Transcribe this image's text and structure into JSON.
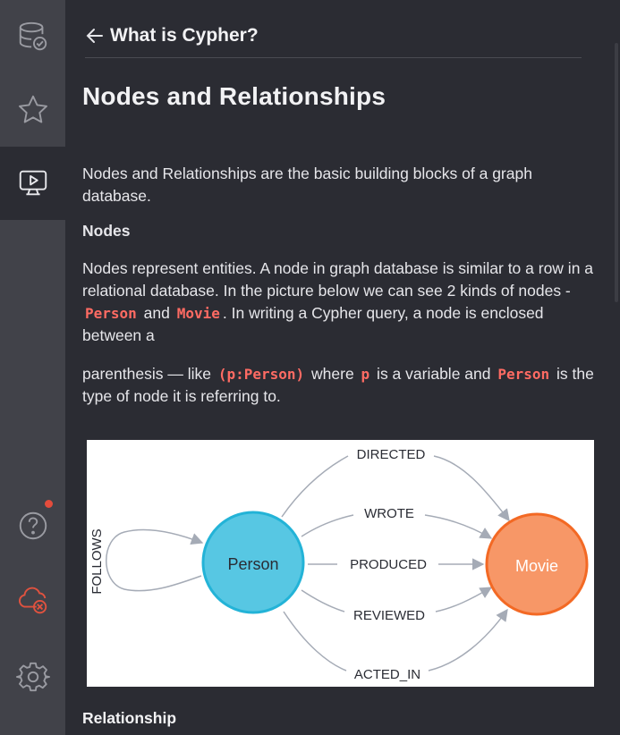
{
  "header": {
    "title": "What is Cypher?"
  },
  "page": {
    "title": "Nodes and Relationships"
  },
  "intro": "Nodes and Relationships are the basic building blocks of a graph database.",
  "nodes_heading": "Nodes",
  "nodes_para": {
    "t1": "Nodes represent entities. A node in graph database is similar to a row in a relational database. In the picture below we can see 2 kinds of nodes - ",
    "c1": "Person",
    "t2": " and ",
    "c2": "Movie",
    "t3": ". In writing a Cypher query, a node is enclosed between a"
  },
  "paren_para": {
    "t1": "parenthesis — like ",
    "c1": "(p:Person)",
    "t2": " where ",
    "c2": "p",
    "t3": " is a variable and ",
    "c3": "Person",
    "t4": " is the type of node it is referring to."
  },
  "diagram": {
    "nodes": {
      "person": "Person",
      "movie": "Movie"
    },
    "edges": {
      "directed": "DIRECTED",
      "wrote": "WROTE",
      "produced": "PRODUCED",
      "reviewed": "REVIEWED",
      "acted_in": "ACTED_IN",
      "follows": "FOLLOWS"
    },
    "colors": {
      "person": "#57c7e3",
      "person_border": "#23b3d7",
      "movie": "#f79767",
      "movie_border": "#f36924",
      "edge": "#a5abb6"
    }
  },
  "relationship_heading": "Relationship",
  "sidebar": {
    "items": [
      {
        "icon": "database-icon"
      },
      {
        "icon": "star-icon"
      },
      {
        "icon": "guides-icon",
        "active": true
      },
      {
        "icon": "help-icon",
        "notification": true
      },
      {
        "icon": "disconnected-cloud-icon"
      },
      {
        "icon": "settings-icon"
      }
    ]
  }
}
